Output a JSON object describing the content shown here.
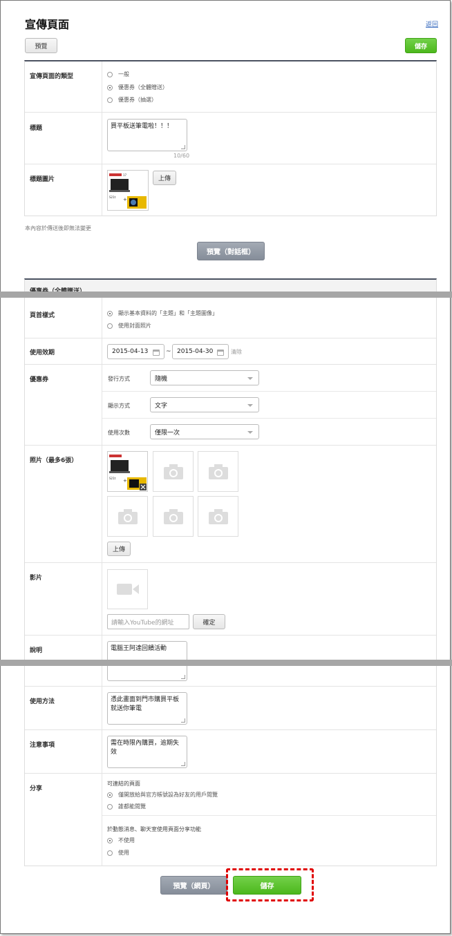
{
  "header": {
    "title": "宣傳頁面",
    "back_link": "返回",
    "preview_label": "預覽",
    "save_label": "儲存"
  },
  "basic": {
    "type_label": "宣傳頁面的類型",
    "type_options": [
      "一般",
      "優惠券（全體贈送）",
      "優惠券（抽選）"
    ],
    "title_label": "標題",
    "title_value": "買平板送筆電啦！！！",
    "title_counter": "10/60",
    "image_label": "標題圖片",
    "upload_label": "上傳"
  },
  "note": "本內容於傳送後即無法變更",
  "preview_chat_label": "預覽（對話框）",
  "coupon_section": {
    "heading": "優惠券（全體贈送）"
  },
  "detail": {
    "style_label": "頁首樣式",
    "style_options": [
      "顯示基本資料的「主題」和「主題圖像」",
      "使用封面照片"
    ],
    "validity_label": "使用效期",
    "date_start": "2015-04-13",
    "date_sep": "~",
    "date_end": "2015-04-30",
    "clear_label": "清除",
    "coupon_label": "優惠券",
    "issue_label": "發行方式",
    "issue_value": "隨機",
    "display_label": "顯示方式",
    "display_value": "文字",
    "uses_label": "使用次數",
    "uses_value": "僅限一次",
    "photos_label": "照片（最多6張）",
    "photos_upload_label": "上傳",
    "video_label": "影片",
    "video_placeholder": "請輸入YouTube的網址",
    "confirm_label": "確定",
    "desc_label": "說明",
    "desc_value": "電腦王阿達回饋活動",
    "usage_label": "使用方法",
    "usage_value": "憑此畫面到門市購買平板就送你筆電",
    "caution_label": "注意事項",
    "caution_value": "需在時限內購買，逾期失效",
    "share_label": "分享",
    "share_sub1": "可連結的頁面",
    "share_options1": [
      "僅開放給與官方帳號設為好友的用戶閱覽",
      "誰都能閱覽"
    ],
    "share_sub2": "於動態消息、聊天室使用頁面分享功能",
    "share_options2": [
      "不使用",
      "使用"
    ]
  },
  "footer": {
    "preview_web_label": "預覽（網頁）",
    "save_label": "儲存"
  },
  "colors": {
    "accent_green": "#4cb81c",
    "dark_button": "#858d99",
    "highlight": "#e00000"
  }
}
